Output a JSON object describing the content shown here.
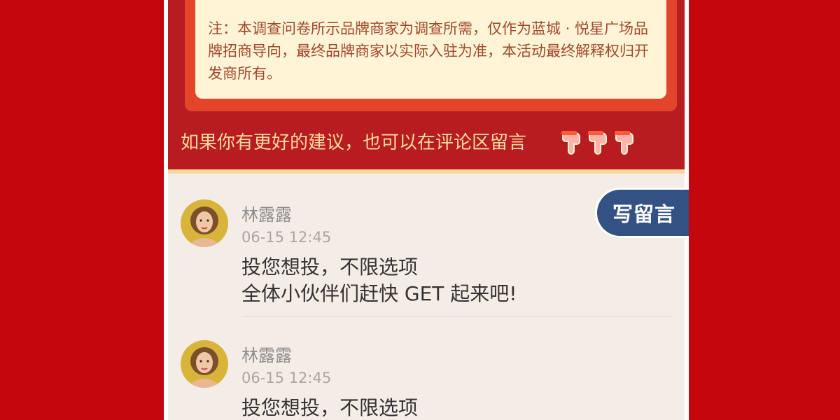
{
  "notice": {
    "text": "注：本调查问卷所示品牌商家为调查所需，仅作为蓝城 · 悦星广场品牌招商导向，最终品牌商家以实际入驻为准，本活动最终解释权归开发商所有。"
  },
  "suggestion": {
    "text": "如果你有更好的建议，也可以在评论区留言",
    "icons": [
      "hand-pointing-down-icon",
      "hand-pointing-down-icon",
      "hand-pointing-down-icon"
    ]
  },
  "write_comment_button": {
    "label": "写留言"
  },
  "comments": [
    {
      "name": "林露露",
      "time": "06-15 12:45",
      "line1": "投您想投，不限选项",
      "line2": "全体小伙伴们赶快 GET 起来吧!"
    },
    {
      "name": "林露露",
      "time": "06-15 12:45",
      "line1": "投您想投，不限选项"
    }
  ],
  "colors": {
    "page_background": "#c4060d",
    "notice_frame": "#e4442a",
    "notice_card": "#fff5d6",
    "write_button": "#345184",
    "comments_background": "#f4ece6"
  }
}
